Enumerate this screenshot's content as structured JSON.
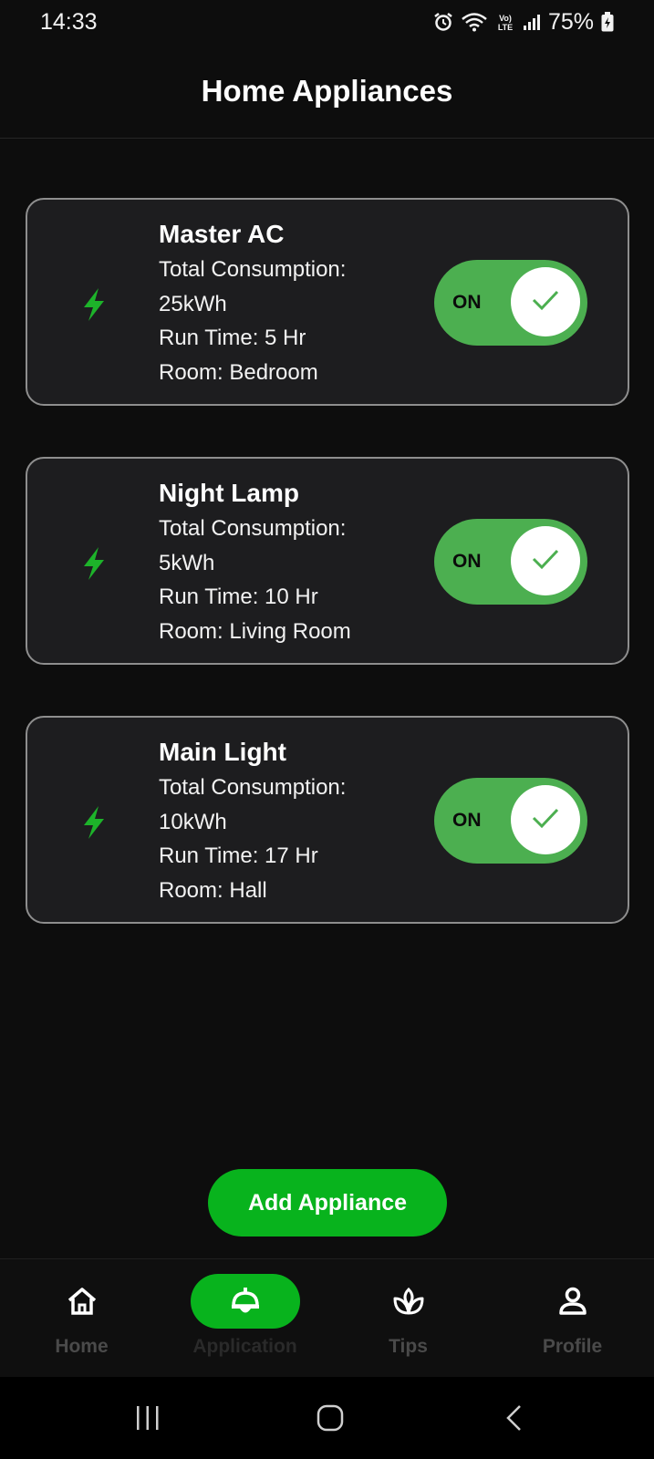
{
  "status_bar": {
    "time": "14:33",
    "battery": "75%",
    "icons": [
      "alarm-icon",
      "wifi-icon",
      "volte-icon",
      "signal-icon",
      "battery-icon"
    ]
  },
  "header": {
    "title": "Home Appliances"
  },
  "appliances": [
    {
      "name": "Master AC",
      "consumption_label": "Total Consumption:",
      "consumption": "25kWh",
      "run_time": "Run Time:  5 Hr",
      "room": "Room:  Bedroom",
      "toggle_label": "ON",
      "state": "on"
    },
    {
      "name": "Night Lamp",
      "consumption_label": "Total Consumption:",
      "consumption": "5kWh",
      "run_time": "Run Time:  10 Hr",
      "room": "Room:  Living Room",
      "toggle_label": "ON",
      "state": "on"
    },
    {
      "name": "Main Light",
      "consumption_label": "Total Consumption:",
      "consumption": "10kWh",
      "run_time": "Run Time:  17 Hr",
      "room": "Room:  Hall",
      "toggle_label": "ON",
      "state": "on"
    }
  ],
  "add_button": {
    "label": "Add Appliance"
  },
  "bottom_nav": {
    "items": [
      {
        "label": "Home",
        "icon": "home-icon"
      },
      {
        "label": "Application",
        "icon": "lamp-icon",
        "active": true
      },
      {
        "label": "Tips",
        "icon": "leaf-icon"
      },
      {
        "label": "Profile",
        "icon": "user-icon"
      }
    ]
  },
  "colors": {
    "background": "#0d0d0d",
    "card": "#1d1d1f",
    "accent_green": "#08b31d",
    "toggle_green": "#4caf50",
    "bolt_green": "#1db32a"
  }
}
